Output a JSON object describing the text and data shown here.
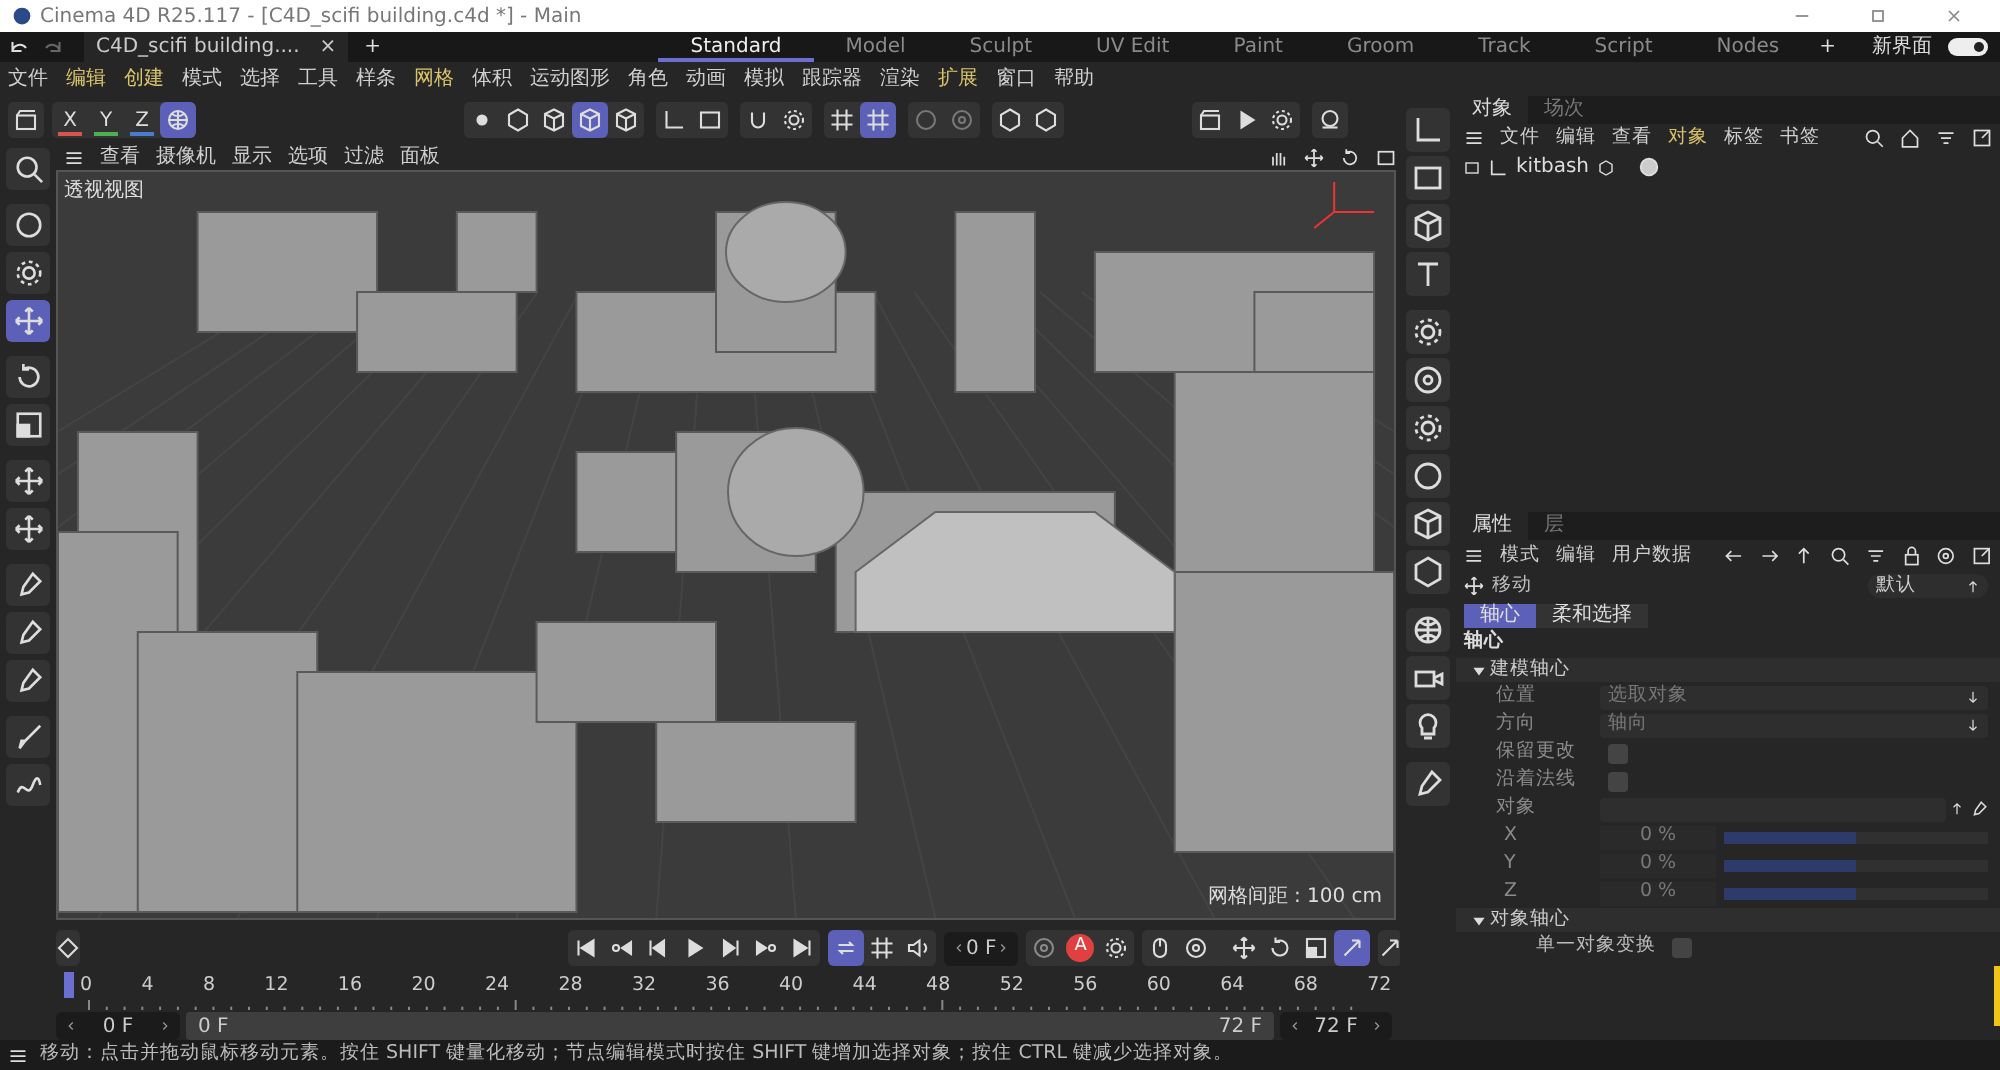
{
  "window": {
    "title": "Cinema 4D R25.117 - [C4D_scifi building.c4d *] - Main"
  },
  "doc_tab": {
    "label": "C4D_scifi building....",
    "close": "×",
    "add": "+"
  },
  "layouts": [
    {
      "label": "Standard",
      "selected": true
    },
    {
      "label": "Model",
      "selected": false
    },
    {
      "label": "Sculpt",
      "selected": false
    },
    {
      "label": "UV Edit",
      "selected": false
    },
    {
      "label": "Paint",
      "selected": false
    },
    {
      "label": "Groom",
      "selected": false
    },
    {
      "label": "Track",
      "selected": false
    },
    {
      "label": "Script",
      "selected": false
    },
    {
      "label": "Nodes",
      "selected": false
    }
  ],
  "layout_add": "+",
  "custom_layout": {
    "label": "新界面",
    "on": true
  },
  "menu": [
    {
      "label": "文件",
      "highlight": false
    },
    {
      "label": "编辑",
      "highlight": true
    },
    {
      "label": "创建",
      "highlight": true
    },
    {
      "label": "模式",
      "highlight": false
    },
    {
      "label": "选择",
      "highlight": false
    },
    {
      "label": "工具",
      "highlight": false
    },
    {
      "label": "样条",
      "highlight": false
    },
    {
      "label": "网格",
      "highlight": true
    },
    {
      "label": "体积",
      "highlight": false
    },
    {
      "label": "运动图形",
      "highlight": false
    },
    {
      "label": "角色",
      "highlight": false
    },
    {
      "label": "动画",
      "highlight": false
    },
    {
      "label": "模拟",
      "highlight": false
    },
    {
      "label": "跟踪器",
      "highlight": false
    },
    {
      "label": "渲染",
      "highlight": false
    },
    {
      "label": "扩展",
      "highlight": true
    },
    {
      "label": "窗口",
      "highlight": false
    },
    {
      "label": "帮助",
      "highlight": false
    }
  ],
  "axes": [
    {
      "label": "X",
      "color": "#d9534f"
    },
    {
      "label": "Y",
      "color": "#4caf50"
    },
    {
      "label": "Z",
      "color": "#4a7bd0"
    }
  ],
  "toolbar": [
    {
      "selected": false
    },
    {
      "selected": true
    },
    {
      "selected": false
    },
    {
      "selected": false
    },
    {
      "selected": false
    },
    {
      "selected": true
    },
    {
      "selected": false
    },
    {
      "selected": false
    },
    {
      "selected": false
    },
    {
      "selected": false
    },
    {
      "selected": false
    },
    {
      "selected": false
    },
    {
      "selected": true
    },
    {
      "selected": false
    },
    {
      "selected": false
    },
    {
      "selected": false
    },
    {
      "selected": false
    },
    {
      "selected": false
    },
    {
      "selected": false
    },
    {
      "selected": false
    },
    {
      "selected": false
    }
  ],
  "view_menu": [
    "查看",
    "摄像机",
    "显示",
    "选项",
    "过滤",
    "面板"
  ],
  "view_label": "透视视图",
  "grid_spacing": "网格间距 : 100 cm",
  "left_tools": [
    {
      "selected": false
    },
    {
      "selected": false
    },
    {
      "selected": false
    },
    {
      "selected": true
    },
    {
      "selected": false
    },
    {
      "selected": false
    },
    {
      "selected": false
    },
    {
      "selected": false
    },
    {
      "selected": false
    },
    {
      "selected": false
    },
    {
      "selected": false
    },
    {
      "selected": false
    },
    {
      "selected": false
    }
  ],
  "objects": {
    "tabs": [
      {
        "label": "对象",
        "selected": true
      },
      {
        "label": "场次",
        "selected": false
      }
    ],
    "menu": [
      {
        "label": "文件",
        "highlight": false
      },
      {
        "label": "编辑",
        "highlight": false
      },
      {
        "label": "查看",
        "highlight": false
      },
      {
        "label": "对象",
        "highlight": true
      },
      {
        "label": "标签",
        "highlight": false
      },
      {
        "label": "书签",
        "highlight": false
      }
    ],
    "rows": [
      {
        "name": "kitbash"
      }
    ]
  },
  "attributes": {
    "tabs": [
      {
        "label": "属性",
        "selected": true
      },
      {
        "label": "层",
        "selected": false
      }
    ],
    "menu": [
      "模式",
      "编辑",
      "用户数据"
    ],
    "tool": "移动",
    "preset": "默认",
    "subtabs": [
      {
        "label": "轴心",
        "selected": true
      },
      {
        "label": "柔和选择",
        "selected": false
      }
    ],
    "section": "轴心",
    "groups": [
      {
        "title": "建模轴心",
        "expanded": true,
        "rows": [
          {
            "kind": "dropdown",
            "label": "位置",
            "value": "选取对象"
          },
          {
            "kind": "dropdown",
            "label": "方向",
            "value": "轴向"
          },
          {
            "kind": "checkbox",
            "label": "保留更改",
            "checked": false
          },
          {
            "kind": "checkbox",
            "label": "沿着法线",
            "checked": false
          },
          {
            "kind": "link",
            "label": "对象"
          },
          {
            "kind": "slider",
            "label": "X",
            "value": "0 %",
            "level": 0.5
          },
          {
            "kind": "slider",
            "label": "Y",
            "value": "0 %",
            "level": 0.5
          },
          {
            "kind": "slider",
            "label": "Z",
            "value": "0 %",
            "level": 0.5
          }
        ]
      },
      {
        "title": "对象轴心",
        "expanded": true,
        "rows": [
          {
            "kind": "checkbox",
            "label": "单一对象变换",
            "checked": false
          }
        ]
      }
    ]
  },
  "timeline": {
    "frame": "0 F",
    "record_key": "A",
    "buttons": [
      {
        "selected": false
      },
      {
        "selected": false
      },
      {
        "selected": false
      },
      {
        "selected": false
      },
      {
        "selected": false
      },
      {
        "selected": false
      },
      {
        "selected": false
      },
      {
        "selected": true
      },
      {
        "selected": false
      },
      {
        "selected": false
      }
    ],
    "ruler": [
      "0",
      "4",
      "8",
      "12",
      "16",
      "20",
      "24",
      "28",
      "32",
      "36",
      "40",
      "44",
      "48",
      "52",
      "56",
      "60",
      "64",
      "68",
      "72"
    ],
    "playhead": {
      "level": 0
    },
    "range": {
      "start": "0 F",
      "min": "0 F",
      "max": "72 F",
      "end": "72 F"
    },
    "end_tools": [
      {
        "selected": false
      },
      {
        "selected": false
      },
      {
        "selected": false
      },
      {
        "selected": false
      },
      {
        "selected": false
      },
      {
        "selected": true
      }
    ]
  },
  "status": "移动：点击并拖动鼠标移动元素。按住 SHIFT 键量化移动；节点编辑模式时按住 SHIFT 键增加选择对象；按住 CTRL 键减少选择对象。"
}
